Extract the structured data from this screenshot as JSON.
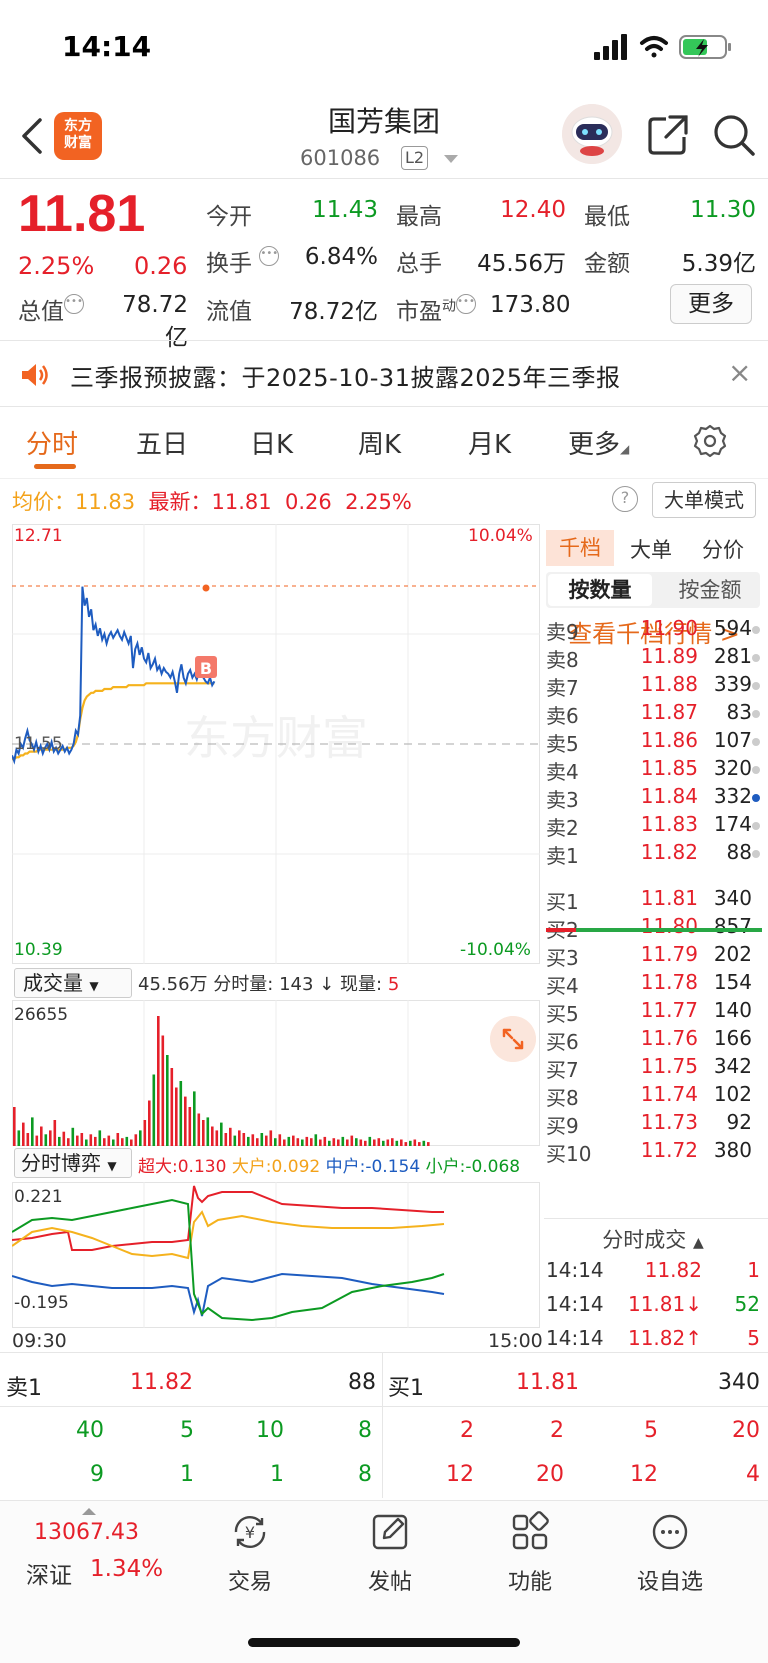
{
  "status_bar": {
    "time": "14:14"
  },
  "header": {
    "stock_name": "国芳集团",
    "stock_code": "601086",
    "level_badge": "L2",
    "logo_line1": "东方",
    "logo_line2": "财富"
  },
  "quote": {
    "price": "11.81",
    "change_pct": "2.25%",
    "change_amt": "0.26",
    "open_label": "今开",
    "open": "11.43",
    "high_label": "最高",
    "high": "12.40",
    "low_label": "最低",
    "low": "11.30",
    "turnover_label": "换手",
    "turnover": "6.84%",
    "volume_label": "总手",
    "volume": "45.56万",
    "amount_label": "金额",
    "amount": "5.39亿",
    "mktcap_label": "总值",
    "mktcap": "78.72亿",
    "float_label": "流值",
    "float_cap": "78.72亿",
    "pe_label": "市盈",
    "pe_sup": "动",
    "pe": "173.80",
    "more_label": "更多"
  },
  "notice": {
    "text": "三季报预披露：于2025-10-31披露2025年三季报",
    "close": "×"
  },
  "tabs": [
    "分时",
    "五日",
    "日K",
    "周K",
    "月K",
    "更多"
  ],
  "info_line": {
    "avg_label": "均价：",
    "avg": "11.83",
    "latest_label": "最新：",
    "latest": "11.81",
    "latest_chg": "0.26",
    "latest_pct": "2.25%",
    "help": "?",
    "big_order_mode": "大单模式"
  },
  "main_chart": {
    "y_top": "12.71",
    "y_mid": "11.55",
    "y_bottom": "10.39",
    "pct_top": "10.04%",
    "pct_bottom": "-10.04%",
    "watermark": "东方财富",
    "buy_marker": "B",
    "colors": {
      "price": "#1e5cc0",
      "avg": "#f5b21d",
      "limit": "#f26322"
    }
  },
  "chart_data": {
    "type": "line",
    "y_range": [
      10.39,
      12.71
    ],
    "x_range": [
      0,
      240
    ],
    "prev_close": 11.55,
    "series": [
      {
        "values": [
          11.49,
          11.46,
          11.52,
          11.5,
          11.55,
          11.53,
          11.58,
          11.62,
          11.57,
          11.55,
          11.52,
          11.56,
          11.51,
          11.54,
          11.5,
          11.53,
          11.55,
          11.52,
          11.56,
          11.51,
          11.53,
          11.5,
          11.52,
          11.54,
          11.51,
          11.53,
          11.5,
          11.52,
          11.55,
          11.62,
          11.6,
          11.7,
          12.38,
          12.28,
          12.32,
          12.22,
          12.26,
          12.15,
          12.18,
          12.12,
          12.16,
          12.1,
          12.13,
          12.08,
          12.12,
          12.14,
          12.11,
          12.13,
          12.15,
          12.12,
          12.1,
          12.14,
          12.11,
          12.08,
          12.12,
          11.95,
          12.05,
          12.08,
          12.02,
          12.06,
          12.0,
          11.98,
          12.03,
          11.95,
          11.97,
          12.0,
          11.94,
          11.96,
          11.92,
          11.95,
          11.93,
          11.92,
          11.9,
          11.93,
          11.88,
          11.82,
          11.92,
          11.97,
          11.9,
          11.87,
          11.92,
          11.94,
          11.9,
          11.92,
          11.89,
          11.93,
          11.91,
          11.9,
          11.88,
          11.87,
          11.9,
          11.86,
          11.88
        ]
      },
      {
        "values": [
          11.47,
          11.47,
          11.48,
          11.48,
          11.49,
          11.49,
          11.5,
          11.5,
          11.51,
          11.51,
          11.51,
          11.51,
          11.52,
          11.52,
          11.52,
          11.52,
          11.52,
          11.52,
          11.52,
          11.52,
          11.52,
          11.52,
          11.52,
          11.52,
          11.52,
          11.53,
          11.53,
          11.53,
          11.54,
          11.56,
          11.6,
          11.68,
          11.74,
          11.78,
          11.8,
          11.81,
          11.82,
          11.82,
          11.83,
          11.83,
          11.83,
          11.83,
          11.84,
          11.84,
          11.84,
          11.84,
          11.85,
          11.85,
          11.85,
          11.85,
          11.85,
          11.85,
          11.85,
          11.86,
          11.86,
          11.86,
          11.86,
          11.86,
          11.86,
          11.86,
          11.86,
          11.87,
          11.87,
          11.87,
          11.87,
          11.87,
          11.87,
          11.87,
          11.87,
          11.87,
          11.87,
          11.87,
          11.87,
          11.87,
          11.87,
          11.87,
          11.87,
          11.87,
          11.87,
          11.87,
          11.87,
          11.87,
          11.87,
          11.87,
          11.87,
          11.87,
          11.87,
          11.87,
          11.87,
          11.87,
          11.87,
          11.87,
          11.87
        ]
      }
    ]
  },
  "volume": {
    "dropdown": "成交量",
    "total": "45.56万",
    "minute_label": "分时量:",
    "minute_vol": "143",
    "arrow": "↓",
    "now_label": "现量:",
    "now_vol": "5",
    "y_max": "26655",
    "bars": [
      0.3,
      0.12,
      0.18,
      0.1,
      0.22,
      0.08,
      0.15,
      0.09,
      0.12,
      0.2,
      0.07,
      0.11,
      0.06,
      0.14,
      0.08,
      0.1,
      0.05,
      0.09,
      0.07,
      0.12,
      0.06,
      0.08,
      0.05,
      0.1,
      0.06,
      0.07,
      0.05,
      0.09,
      0.12,
      0.2,
      0.35,
      0.55,
      1.0,
      0.85,
      0.7,
      0.6,
      0.45,
      0.5,
      0.38,
      0.3,
      0.42,
      0.25,
      0.2,
      0.22,
      0.15,
      0.12,
      0.18,
      0.1,
      0.14,
      0.08,
      0.12,
      0.1,
      0.07,
      0.09,
      0.06,
      0.1,
      0.08,
      0.12,
      0.06,
      0.09,
      0.05,
      0.07,
      0.08,
      0.06,
      0.05,
      0.07,
      0.06,
      0.09,
      0.05,
      0.07,
      0.04,
      0.06,
      0.05,
      0.07,
      0.05,
      0.08,
      0.06,
      0.05,
      0.04,
      0.07,
      0.05,
      0.06,
      0.04,
      0.05,
      0.06,
      0.04,
      0.05,
      0.03,
      0.04,
      0.05,
      0.03,
      0.04,
      0.03
    ]
  },
  "game": {
    "dropdown": "分时博弈",
    "super_label": "超大:",
    "super": "0.130",
    "big_label": "大户:",
    "big": "0.092",
    "mid_label": "中户:",
    "mid": "-0.154",
    "small_label": "小户:",
    "small": "-0.068",
    "y_top": "0.221",
    "y_bottom": "-0.195",
    "time_start": "09:30",
    "time_end": "15:00"
  },
  "right_panel": {
    "tabs": [
      "千档",
      "大单",
      "分价"
    ],
    "seg_qty": "按数量",
    "seg_amount": "按金额",
    "view_link": "查看千档行情 >",
    "asks": [
      {
        "label": "卖9",
        "price": "11.90",
        "vol": "594"
      },
      {
        "label": "卖8",
        "price": "11.89",
        "vol": "281"
      },
      {
        "label": "卖7",
        "price": "11.88",
        "vol": "339"
      },
      {
        "label": "卖6",
        "price": "11.87",
        "vol": "83"
      },
      {
        "label": "卖5",
        "price": "11.86",
        "vol": "107"
      },
      {
        "label": "卖4",
        "price": "11.85",
        "vol": "320"
      },
      {
        "label": "卖3",
        "price": "11.84",
        "vol": "332"
      },
      {
        "label": "卖2",
        "price": "11.83",
        "vol": "174"
      },
      {
        "label": "卖1",
        "price": "11.82",
        "vol": "88"
      }
    ],
    "bids": [
      {
        "label": "买1",
        "price": "11.81",
        "vol": "340"
      },
      {
        "label": "买2",
        "price": "11.80",
        "vol": "857"
      },
      {
        "label": "买3",
        "price": "11.79",
        "vol": "202"
      },
      {
        "label": "买4",
        "price": "11.78",
        "vol": "154"
      },
      {
        "label": "买5",
        "price": "11.77",
        "vol": "140"
      },
      {
        "label": "买6",
        "price": "11.76",
        "vol": "166"
      },
      {
        "label": "买7",
        "price": "11.75",
        "vol": "342"
      },
      {
        "label": "买8",
        "price": "11.74",
        "vol": "102"
      },
      {
        "label": "买9",
        "price": "11.73",
        "vol": "92"
      },
      {
        "label": "买10",
        "price": "11.72",
        "vol": "380"
      }
    ],
    "ticks_title": "分时成交",
    "ticks": [
      {
        "time": "14:14",
        "price": "11.82",
        "vol": "1"
      },
      {
        "time": "14:14",
        "price": "11.81↓",
        "vol": "52"
      },
      {
        "time": "14:14",
        "price": "11.82↑",
        "vol": "5"
      }
    ]
  },
  "bottom_quote": {
    "sell1_label": "卖1",
    "sell1_price": "11.82",
    "sell1_vol": "88",
    "buy1_label": "买1",
    "buy1_price": "11.81",
    "buy1_vol": "340",
    "sell_row1": [
      "40",
      "5",
      "10",
      "8"
    ],
    "sell_row2": [
      "9",
      "1",
      "1",
      "8"
    ],
    "buy_row1": [
      "2",
      "2",
      "5",
      "20"
    ],
    "buy_row2": [
      "12",
      "20",
      "12",
      "4"
    ]
  },
  "bottom_nav": {
    "index_value": "13067.43",
    "index_name": "深证",
    "index_pct": "1.34%",
    "trade": "交易",
    "post": "发帖",
    "function": "功能",
    "watchlist": "设自选"
  }
}
